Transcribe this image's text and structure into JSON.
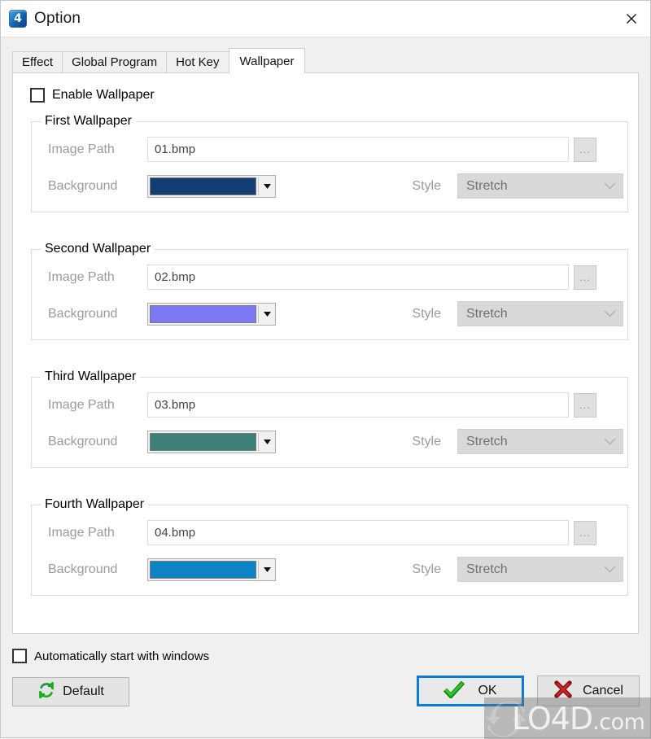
{
  "window": {
    "title": "Option",
    "app_icon": "app-logo-4",
    "close_icon": "close-icon"
  },
  "tabs": [
    {
      "label": "Effect",
      "selected": false
    },
    {
      "label": "Global Program",
      "selected": false
    },
    {
      "label": "Hot Key",
      "selected": false
    },
    {
      "label": "Wallpaper",
      "selected": true
    }
  ],
  "page": {
    "enable_wallpaper": {
      "label": "Enable Wallpaper",
      "checked": false
    },
    "labels": {
      "image_path": "Image Path",
      "background": "Background",
      "style": "Style",
      "browse": "..."
    },
    "groups": [
      {
        "title": "First Wallpaper",
        "image_path": "01.bmp",
        "background_color": "#133e73",
        "style": "Stretch"
      },
      {
        "title": "Second Wallpaper",
        "image_path": "02.bmp",
        "background_color": "#7b79f4",
        "style": "Stretch"
      },
      {
        "title": "Third Wallpaper",
        "image_path": "03.bmp",
        "background_color": "#3d8079",
        "style": "Stretch"
      },
      {
        "title": "Fourth Wallpaper",
        "image_path": "04.bmp",
        "background_color": "#0b83c4",
        "style": "Stretch"
      }
    ]
  },
  "footer": {
    "autostart": {
      "label": "Automatically start with windows",
      "checked": false
    },
    "default_button": "Default",
    "ok_button": "OK",
    "cancel_button": "Cancel"
  },
  "watermark": {
    "text": "LO4D",
    "suffix": ".com"
  },
  "colors": {
    "accent": "#0a7bd6",
    "ok_check": "#1aa818",
    "cancel_x": "#9f1414",
    "default_icon": "#18b018"
  }
}
